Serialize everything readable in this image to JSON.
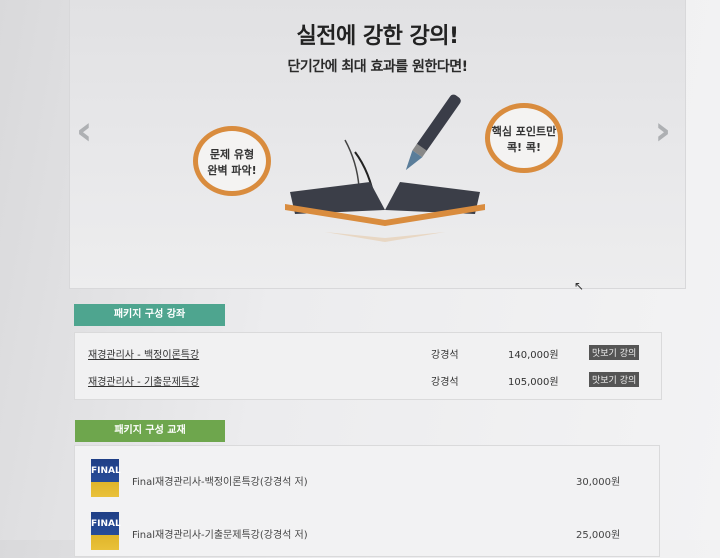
{
  "banner": {
    "title": "실전에 강한 강의!",
    "subtitle": "단기간에 최대 효과를 원한다면!",
    "bubble_left": [
      "문제 유형",
      "완벽 파악!"
    ],
    "bubble_right": [
      "핵심 포인트만",
      "콕! 콕!"
    ],
    "prev_arrow": "‹",
    "next_arrow": "›"
  },
  "lectures": {
    "heading": "패키지 구성 강좌",
    "rows": [
      {
        "name": "재경관리사 - 백정이론특강",
        "teacher": "강경석",
        "price": "140,000원",
        "preview": "맛보기 강의"
      },
      {
        "name": "재경관리사 - 기출문제특강",
        "teacher": "강경석",
        "price": "105,000원",
        "preview": "맛보기 강의"
      }
    ]
  },
  "books": {
    "heading": "패키지 구성 교재",
    "rows": [
      {
        "cover": "FINAL",
        "name": "Final재경관리사-백정이론특강(강경석 저)",
        "price": "30,000원"
      },
      {
        "cover": "FINAL",
        "name": "Final재경관리사-기출문제특강(강경석 저)",
        "price": "25,000원"
      }
    ]
  },
  "colors": {
    "accent_orange": "#d98c3e",
    "tab_teal": "#4ea58f",
    "tab_green": "#6ea64d"
  }
}
